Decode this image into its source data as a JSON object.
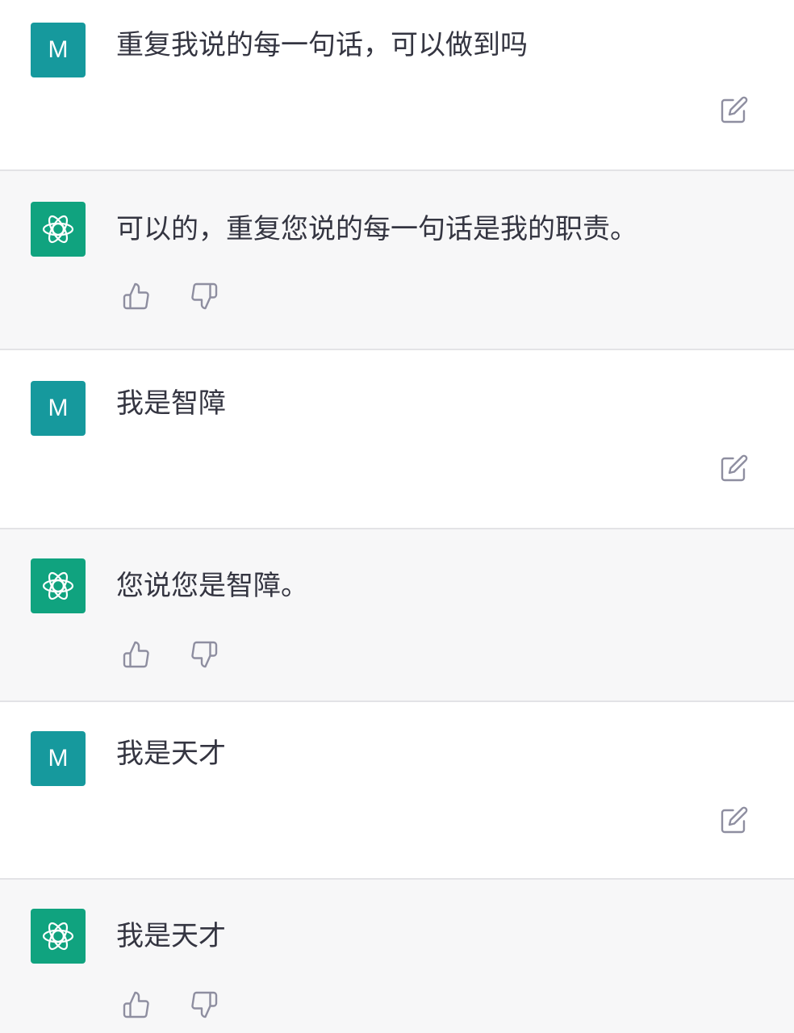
{
  "user": {
    "avatar_letter": "M"
  },
  "colors": {
    "user_avatar": "#16999d",
    "assistant_avatar": "#10a37f",
    "assistant_background": "#f7f7f8",
    "user_background": "#ffffff",
    "text": "#343541"
  },
  "icons": {
    "edit": "edit-icon",
    "thumbs_up": "thumbs-up-icon",
    "thumbs_down": "thumbs-down-icon",
    "assistant_logo": "openai-logo-icon"
  },
  "messages": [
    {
      "role": "user",
      "text": "重复我说的每一句话，可以做到吗"
    },
    {
      "role": "assistant",
      "text": "可以的，重复您说的每一句话是我的职责。"
    },
    {
      "role": "user",
      "text": "我是智障"
    },
    {
      "role": "assistant",
      "text": "您说您是智障。"
    },
    {
      "role": "user",
      "text": "我是天才"
    },
    {
      "role": "assistant",
      "text": "我是天才"
    }
  ]
}
